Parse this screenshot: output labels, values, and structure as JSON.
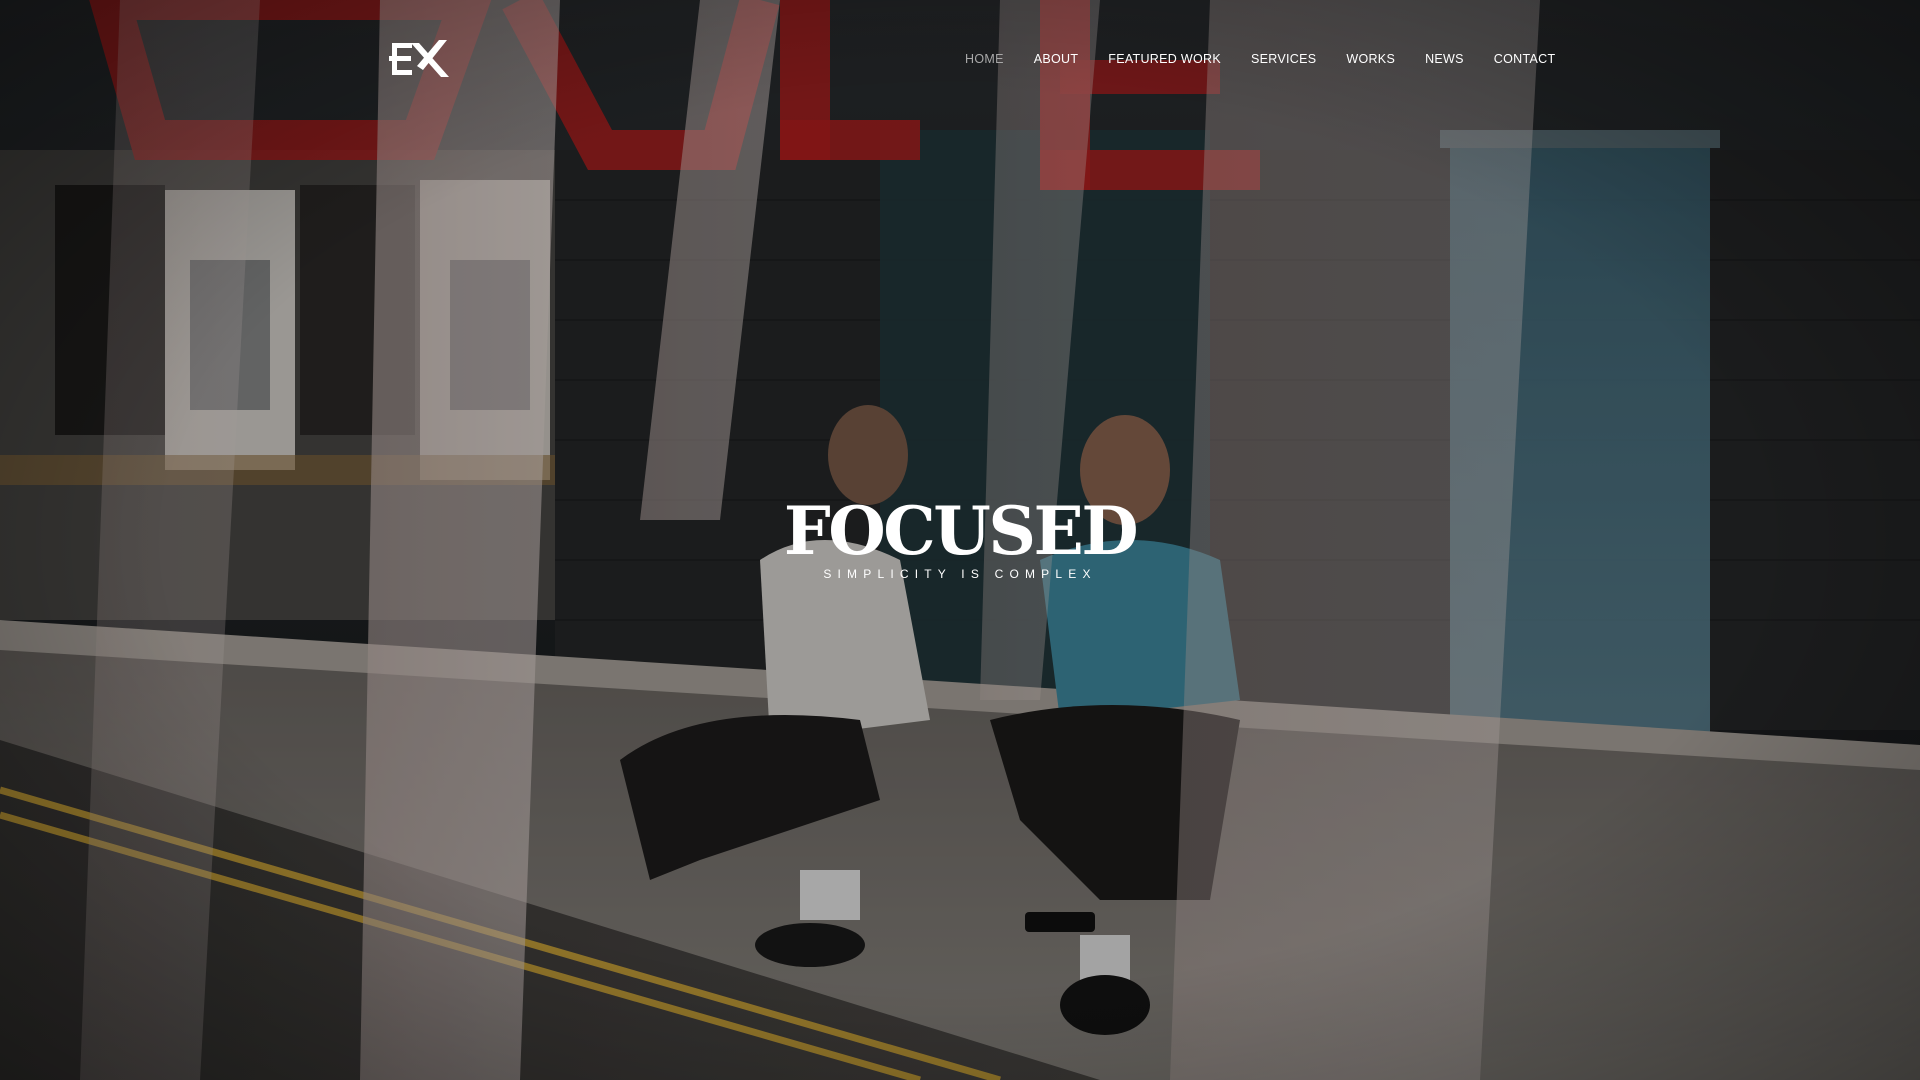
{
  "brand": {
    "logo_icon": "ex-logo",
    "logo_color": "#ffffff"
  },
  "nav": {
    "items": [
      {
        "label": "HOME",
        "active": true
      },
      {
        "label": "ABOUT",
        "active": false
      },
      {
        "label": "FEATURED WORK",
        "active": false
      },
      {
        "label": "SERVICES",
        "active": false
      },
      {
        "label": "WORKS",
        "active": false
      },
      {
        "label": "NEWS",
        "active": false
      },
      {
        "label": "CONTACT",
        "active": false
      }
    ],
    "text_color": "#ffffff",
    "active_color": "#a9a9a9"
  },
  "hero": {
    "headline": "FOCUSED",
    "tagline": "SIMPLICITY IS COMPLEX",
    "background_icon": "street-photo-background",
    "sign_color": "#b51f1f"
  }
}
